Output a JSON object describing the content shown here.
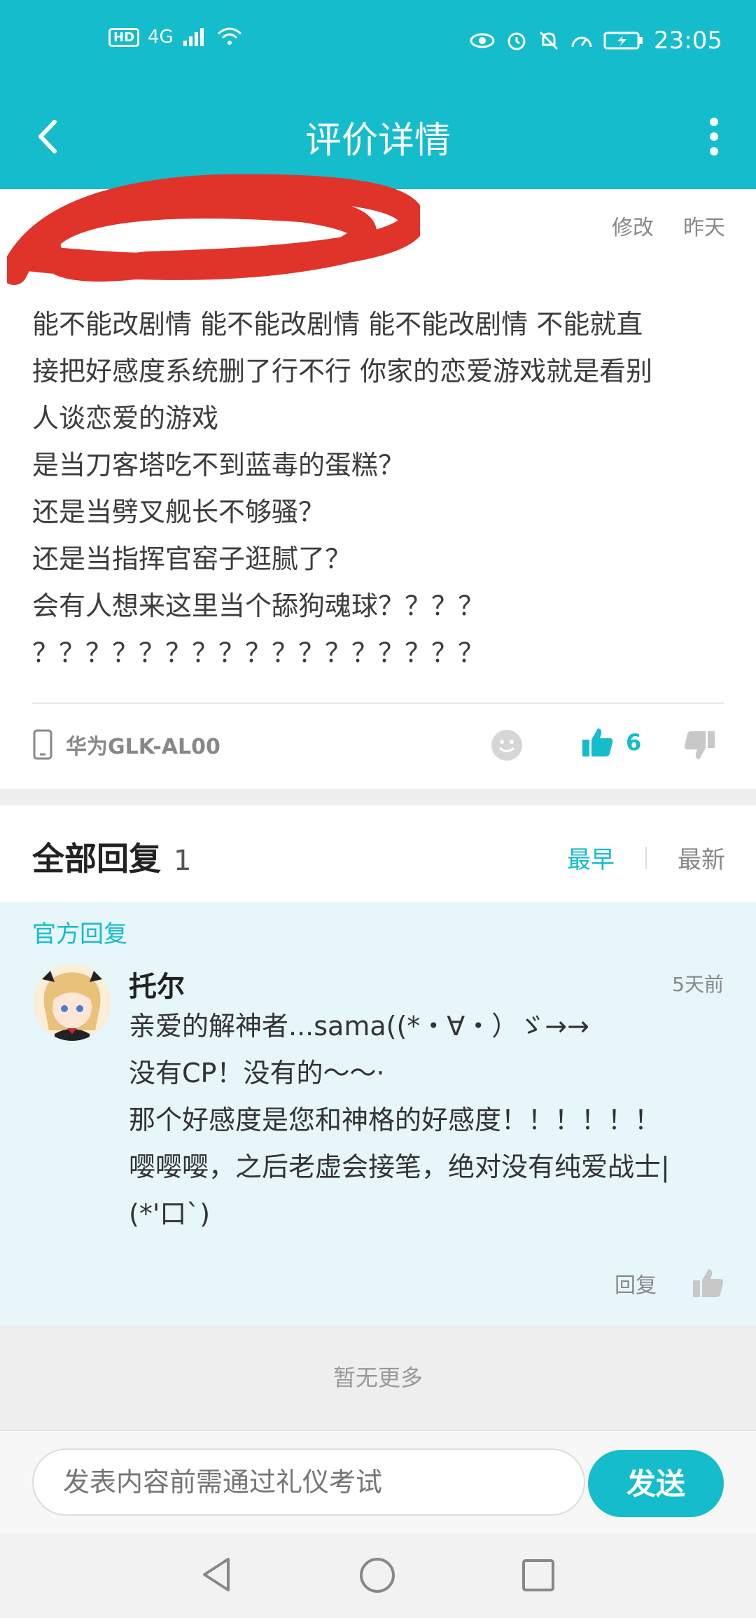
{
  "status_bar": {
    "hd": "HD",
    "network": "4G",
    "time": "23:05"
  },
  "navbar": {
    "title": "评价详情"
  },
  "review": {
    "meta_edit": "修改",
    "meta_time": "昨天",
    "text": "能不能改剧情 能不能改剧情 能不能改剧情 不能就直\n接把好感度系统删了行不行 你家的恋爱游戏就是看别\n人谈恋爱的游戏\n是当刀客塔吃不到蓝毒的蛋糕？\n还是当劈叉舰长不够骚？\n还是当指挥官窑子逛腻了？\n会有人想来这里当个舔狗魂球？？？？\n？？？？？？？？？？？？？？？？？",
    "device": "华为GLK-AL00",
    "likes": "6"
  },
  "replies": {
    "title": "全部回复",
    "count": "1",
    "sort_earliest": "最早",
    "sort_latest": "最新",
    "official_label": "官方回复",
    "items": [
      {
        "name": "托尔",
        "time": "5天前",
        "text": "亲爱的解神者...sama((*・∀・）ゞ→→\n没有CP！没有的～～·\n那个好感度是您和神格的好感度！！！！！！\n嘤嘤嘤，之后老虚会接笔，绝对没有纯爱战士|\n(*'口`)",
        "reply_label": "回复"
      }
    ]
  },
  "footer": {
    "no_more": "暂无更多"
  },
  "input_bar": {
    "placeholder": "发表内容前需通过礼仪考试",
    "send_label": "发送"
  },
  "colors": {
    "accent": "#15bccb",
    "official_bg": "#e6f6f9"
  }
}
